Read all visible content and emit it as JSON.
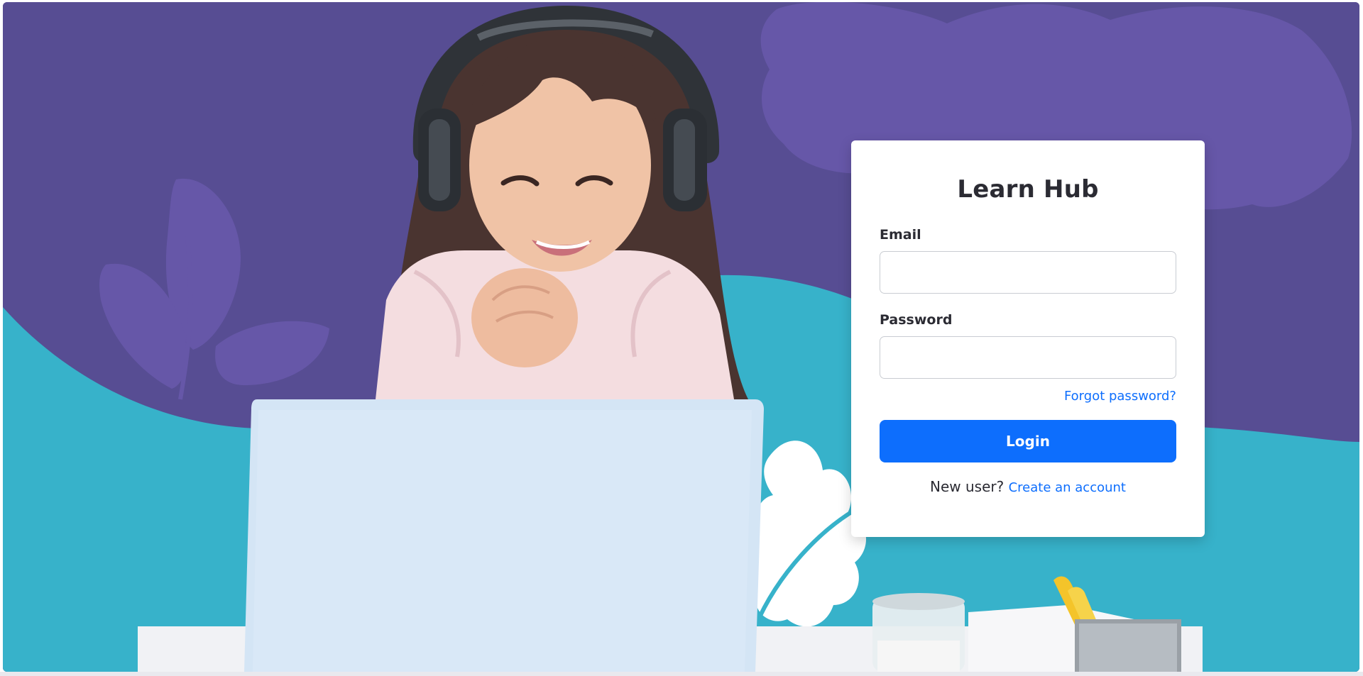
{
  "app": {
    "title": "Learn Hub"
  },
  "login_form": {
    "email_label": "Email",
    "email_value": "",
    "password_label": "Password",
    "password_value": "",
    "forgot_password_link": "Forgot password?",
    "login_button": "Login",
    "new_user_text": "New user?",
    "create_account_link": "Create an account"
  },
  "colors": {
    "primary": "#0d6efd",
    "background_purple": "#574d93",
    "background_teal": "#37b2ca",
    "card": "#ffffff"
  },
  "hero_image": {
    "icon": "girl-with-laptop-illustration"
  }
}
